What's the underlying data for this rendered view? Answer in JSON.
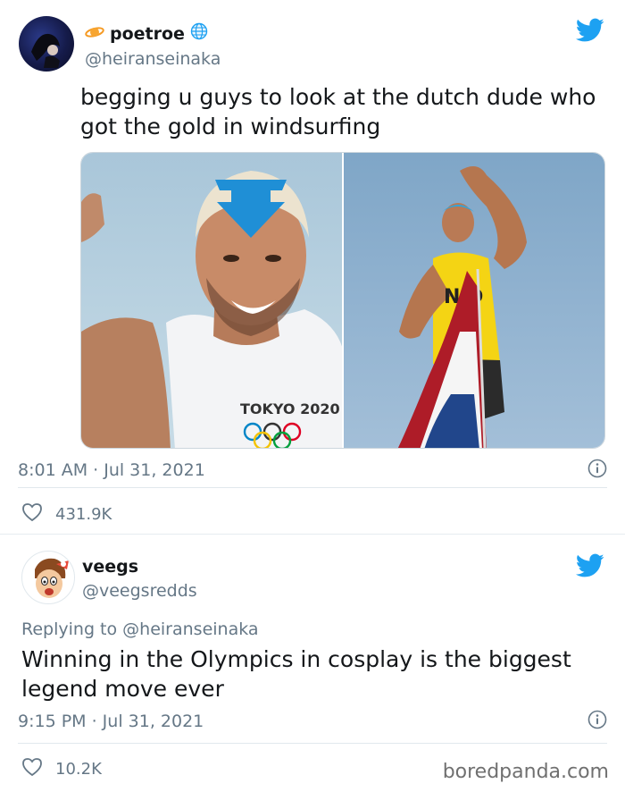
{
  "tweets": [
    {
      "display_name": "poetroe",
      "handle": "@heiranseinaka",
      "text": "begging u guys to look at the dutch dude who got the gold in windsurfing",
      "timestamp": "8:01 AM · Jul 31, 2021",
      "likes": "431.9K",
      "media_caption": "TOKYO 2020"
    },
    {
      "display_name": "veegs",
      "handle": "@veegsredds",
      "replying_prefix": "Replying to",
      "replying_handle": "@heiranseinaka",
      "text": "Winning in the Olympics in cosplay is the biggest legend move ever",
      "timestamp": "9:15 PM · Jul 31, 2021",
      "likes": "10.2K"
    }
  ],
  "watermark": "boredpanda.com",
  "colors": {
    "twitter_blue": "#1da1f2",
    "secondary_text": "#657786",
    "primary_text": "#14171a"
  },
  "icons": [
    "twitter-bird-icon",
    "heart-icon",
    "info-icon",
    "verified-globe-icon",
    "orange-planet-emoji"
  ]
}
